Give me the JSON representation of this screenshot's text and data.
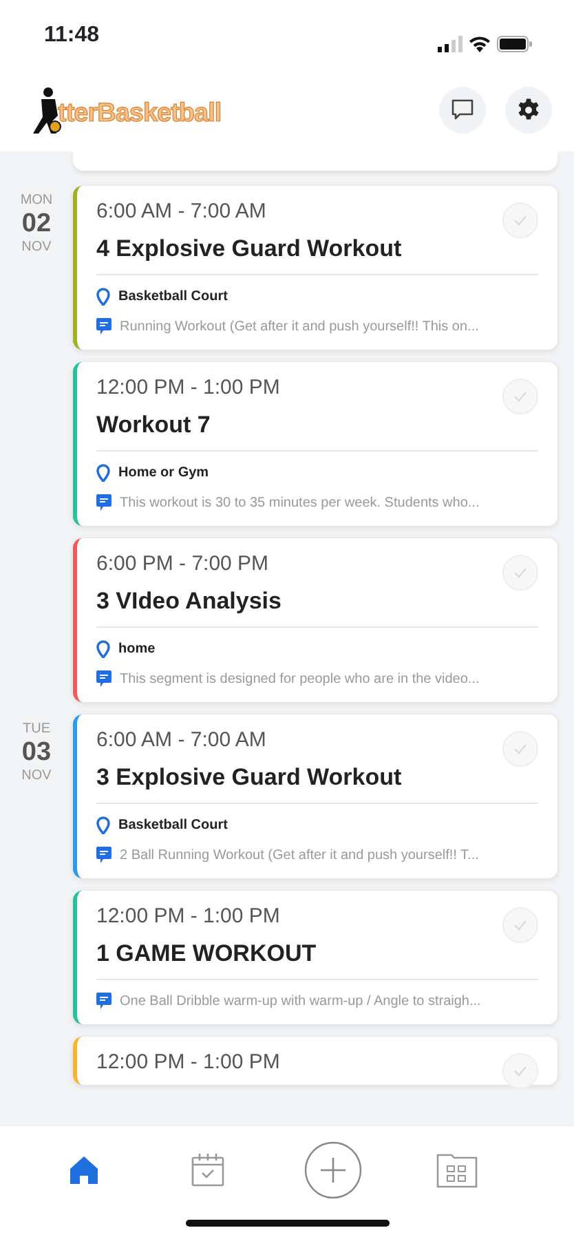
{
  "status_bar": {
    "time": "11:48"
  },
  "header": {
    "logo_text": "tterBasketball"
  },
  "days": [
    {
      "weekday": "MON",
      "day": "02",
      "month": "NOV",
      "events": [
        {
          "time": "6:00 AM - 7:00 AM",
          "title": "4 Explosive Guard Workout",
          "location": "Basketball Court",
          "note": "Running Workout  (Get after it and push yourself!!  This on...",
          "color": "#a3b02a",
          "completed": false
        },
        {
          "time": "12:00 PM - 1:00 PM",
          "title": "Workout 7",
          "location": "Home or Gym",
          "note": "This workout is 30 to 35 minutes per week.  Students who...",
          "color": "#2bbf9a",
          "completed": false
        },
        {
          "time": "6:00 PM - 7:00 PM",
          "title": "3 VIdeo Analysis",
          "location": "home",
          "note": "This segment is designed for people who are in the video...",
          "color": "#ef5b5b",
          "completed": false
        }
      ]
    },
    {
      "weekday": "TUE",
      "day": "03",
      "month": "NOV",
      "events": [
        {
          "time": "6:00 AM - 7:00 AM",
          "title": "3 Explosive Guard Workout",
          "location": "Basketball Court",
          "note": "2 Ball Running Workout  (Get after it and push yourself!!  T...",
          "color": "#2f9be8",
          "completed": false
        },
        {
          "time": "12:00 PM - 1:00 PM",
          "title": "1 GAME WORKOUT",
          "note": "One Ball Dribble warm-up with warm-up / Angle to straigh...",
          "color": "#2bbf9a",
          "completed": false
        },
        {
          "time": "12:00 PM - 1:00 PM",
          "color": "#f2b632",
          "completed": false
        }
      ]
    }
  ],
  "tab_bar": [
    {
      "kind": "home",
      "selected": true
    },
    {
      "kind": "calendar",
      "selected": false
    },
    {
      "kind": "add",
      "selected": false
    },
    {
      "kind": "library",
      "selected": false
    }
  ]
}
